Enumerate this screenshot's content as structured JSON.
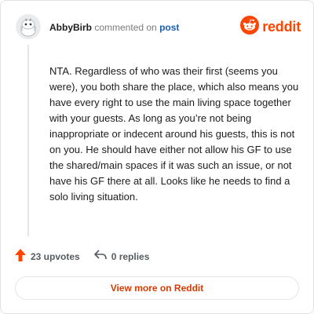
{
  "header": {
    "username": "AbbyBirb",
    "verb": "commented on",
    "post_link": "post",
    "brand": "reddit"
  },
  "comment": {
    "body": "NTA. Regardless of who was their first (seems you were), you both share the place, which also means you have every right to use the main living space together with your guests. As long as you’re not being inappropriate or indecent around his guests, this is not on you. He should have either not allow his GF to use the shared/main spaces if it was such an issue, or not have his GF there at all. Looks like he needs to find a solo living situation."
  },
  "actions": {
    "upvotes": "23 upvotes",
    "replies": "0 replies"
  },
  "footer": {
    "view_button": "View more on Reddit"
  },
  "icons": {
    "avatar": "snoo-avatar-icon",
    "brand": "reddit-logo-icon",
    "upvote": "upvote-arrow-icon",
    "reply": "reply-arrow-icon"
  },
  "colors": {
    "brand": "#ff4500",
    "link": "#1a5fb4",
    "upvote": "#ff4500",
    "button_text": "#d93a00"
  }
}
